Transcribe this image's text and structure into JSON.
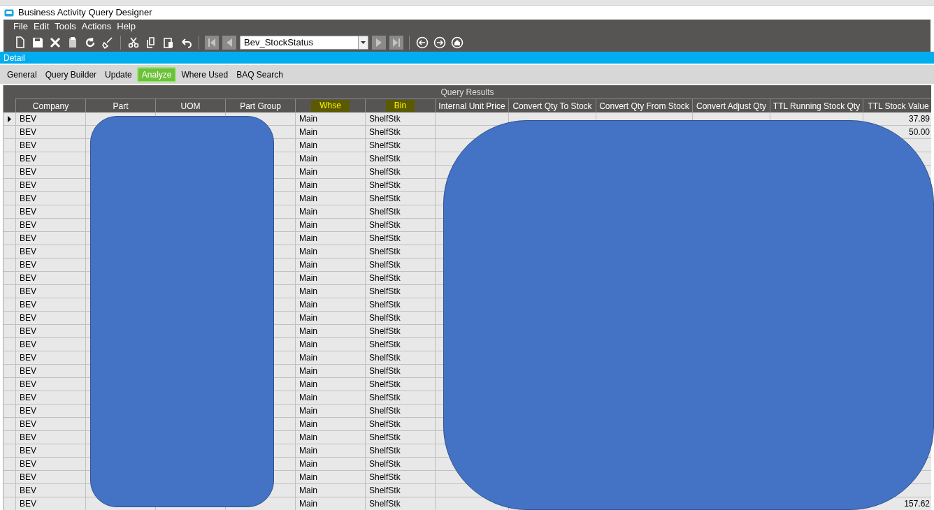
{
  "window": {
    "title": "Business Activity Query Designer"
  },
  "menu": [
    "File",
    "Edit",
    "Tools",
    "Actions",
    "Help"
  ],
  "toolbar": {
    "query_id": "Bev_StockStatus"
  },
  "panel_title": "Detail",
  "tabs": [
    {
      "label": "General",
      "selected": false
    },
    {
      "label": "Query Builder",
      "selected": false
    },
    {
      "label": "Update",
      "selected": false
    },
    {
      "label": "Analyze",
      "selected": true
    },
    {
      "label": "Where Used",
      "selected": false
    },
    {
      "label": "BAQ Search",
      "selected": false
    }
  ],
  "results": {
    "title": "Query Results",
    "columns": [
      {
        "label": "Company",
        "highlighted": false
      },
      {
        "label": "Part",
        "highlighted": false
      },
      {
        "label": "UOM",
        "highlighted": false
      },
      {
        "label": "Part Group",
        "highlighted": false
      },
      {
        "label": "Whse",
        "highlighted": true
      },
      {
        "label": "Bin",
        "highlighted": true
      },
      {
        "label": "Internal Unit Price",
        "highlighted": false
      },
      {
        "label": "Convert Qty To Stock",
        "highlighted": false
      },
      {
        "label": "Convert Qty From Stock",
        "highlighted": false
      },
      {
        "label": "Convert Adjust Qty",
        "highlighted": false
      },
      {
        "label": "TTL Running Stock Qty",
        "highlighted": false
      },
      {
        "label": "TTL Stock Value",
        "highlighted": false
      }
    ],
    "rows": [
      {
        "selected": true,
        "cells": [
          "BEV",
          null,
          null,
          null,
          "Main",
          "ShelfStk",
          null,
          null,
          null,
          null,
          null,
          "37.89"
        ]
      },
      {
        "selected": false,
        "cells": [
          "BEV",
          null,
          null,
          null,
          "Main",
          "ShelfStk",
          null,
          null,
          null,
          null,
          null,
          "50.00"
        ]
      },
      {
        "selected": false,
        "cells": [
          "BEV",
          null,
          null,
          null,
          "Main",
          "ShelfStk",
          null,
          null,
          null,
          null,
          null,
          null
        ]
      },
      {
        "selected": false,
        "cells": [
          "BEV",
          null,
          null,
          null,
          "Main",
          "ShelfStk",
          null,
          null,
          null,
          null,
          null,
          null
        ]
      },
      {
        "selected": false,
        "cells": [
          "BEV",
          null,
          null,
          null,
          "Main",
          "ShelfStk",
          null,
          null,
          null,
          null,
          null,
          null
        ]
      },
      {
        "selected": false,
        "cells": [
          "BEV",
          null,
          null,
          null,
          "Main",
          "ShelfStk",
          null,
          null,
          null,
          null,
          null,
          null
        ]
      },
      {
        "selected": false,
        "cells": [
          "BEV",
          null,
          null,
          null,
          "Main",
          "ShelfStk",
          null,
          null,
          null,
          null,
          null,
          null
        ]
      },
      {
        "selected": false,
        "cells": [
          "BEV",
          null,
          null,
          null,
          "Main",
          "ShelfStk",
          null,
          null,
          null,
          null,
          null,
          null
        ]
      },
      {
        "selected": false,
        "cells": [
          "BEV",
          null,
          null,
          null,
          "Main",
          "ShelfStk",
          null,
          null,
          null,
          null,
          null,
          null
        ]
      },
      {
        "selected": false,
        "cells": [
          "BEV",
          null,
          null,
          null,
          "Main",
          "ShelfStk",
          null,
          null,
          null,
          null,
          null,
          null
        ]
      },
      {
        "selected": false,
        "cells": [
          "BEV",
          null,
          null,
          null,
          "Main",
          "ShelfStk",
          null,
          null,
          null,
          null,
          null,
          null
        ]
      },
      {
        "selected": false,
        "cells": [
          "BEV",
          null,
          null,
          null,
          "Main",
          "ShelfStk",
          null,
          null,
          null,
          null,
          null,
          null
        ]
      },
      {
        "selected": false,
        "cells": [
          "BEV",
          null,
          null,
          null,
          "Main",
          "ShelfStk",
          null,
          null,
          null,
          null,
          null,
          null
        ]
      },
      {
        "selected": false,
        "cells": [
          "BEV",
          null,
          null,
          null,
          "Main",
          "ShelfStk",
          null,
          null,
          null,
          null,
          null,
          null
        ]
      },
      {
        "selected": false,
        "cells": [
          "BEV",
          null,
          null,
          null,
          "Main",
          "ShelfStk",
          null,
          null,
          null,
          null,
          null,
          null
        ]
      },
      {
        "selected": false,
        "cells": [
          "BEV",
          null,
          null,
          null,
          "Main",
          "ShelfStk",
          null,
          null,
          null,
          null,
          null,
          null
        ]
      },
      {
        "selected": false,
        "cells": [
          "BEV",
          null,
          null,
          null,
          "Main",
          "ShelfStk",
          null,
          null,
          null,
          null,
          null,
          null
        ]
      },
      {
        "selected": false,
        "cells": [
          "BEV",
          null,
          null,
          null,
          "Main",
          "ShelfStk",
          null,
          null,
          null,
          null,
          null,
          null
        ]
      },
      {
        "selected": false,
        "cells": [
          "BEV",
          null,
          null,
          null,
          "Main",
          "ShelfStk",
          null,
          null,
          null,
          null,
          null,
          null
        ]
      },
      {
        "selected": false,
        "cells": [
          "BEV",
          null,
          null,
          null,
          "Main",
          "ShelfStk",
          null,
          null,
          null,
          null,
          null,
          null
        ]
      },
      {
        "selected": false,
        "cells": [
          "BEV",
          null,
          null,
          null,
          "Main",
          "ShelfStk",
          null,
          null,
          null,
          null,
          null,
          null
        ]
      },
      {
        "selected": false,
        "cells": [
          "BEV",
          null,
          null,
          null,
          "Main",
          "ShelfStk",
          null,
          null,
          null,
          null,
          null,
          null
        ]
      },
      {
        "selected": false,
        "cells": [
          "BEV",
          null,
          null,
          null,
          "Main",
          "ShelfStk",
          null,
          null,
          null,
          null,
          null,
          null
        ]
      },
      {
        "selected": false,
        "cells": [
          "BEV",
          null,
          null,
          null,
          "Main",
          "ShelfStk",
          null,
          null,
          null,
          null,
          null,
          null
        ]
      },
      {
        "selected": false,
        "cells": [
          "BEV",
          null,
          null,
          null,
          "Main",
          "ShelfStk",
          null,
          null,
          null,
          null,
          null,
          null
        ]
      },
      {
        "selected": false,
        "cells": [
          "BEV",
          null,
          null,
          null,
          "Main",
          "ShelfStk",
          null,
          null,
          null,
          null,
          null,
          null
        ]
      },
      {
        "selected": false,
        "cells": [
          "BEV",
          null,
          null,
          null,
          "Main",
          "ShelfStk",
          null,
          null,
          null,
          null,
          null,
          null
        ]
      },
      {
        "selected": false,
        "cells": [
          "BEV",
          null,
          null,
          null,
          "Main",
          "ShelfStk",
          null,
          null,
          null,
          null,
          null,
          null
        ]
      },
      {
        "selected": false,
        "cells": [
          "BEV",
          null,
          null,
          null,
          "Main",
          "ShelfStk",
          null,
          null,
          null,
          null,
          null,
          null
        ]
      },
      {
        "selected": false,
        "cells": [
          "BEV",
          null,
          null,
          null,
          "Main",
          "ShelfStk",
          null,
          null,
          null,
          null,
          null,
          "157.62"
        ]
      }
    ]
  }
}
